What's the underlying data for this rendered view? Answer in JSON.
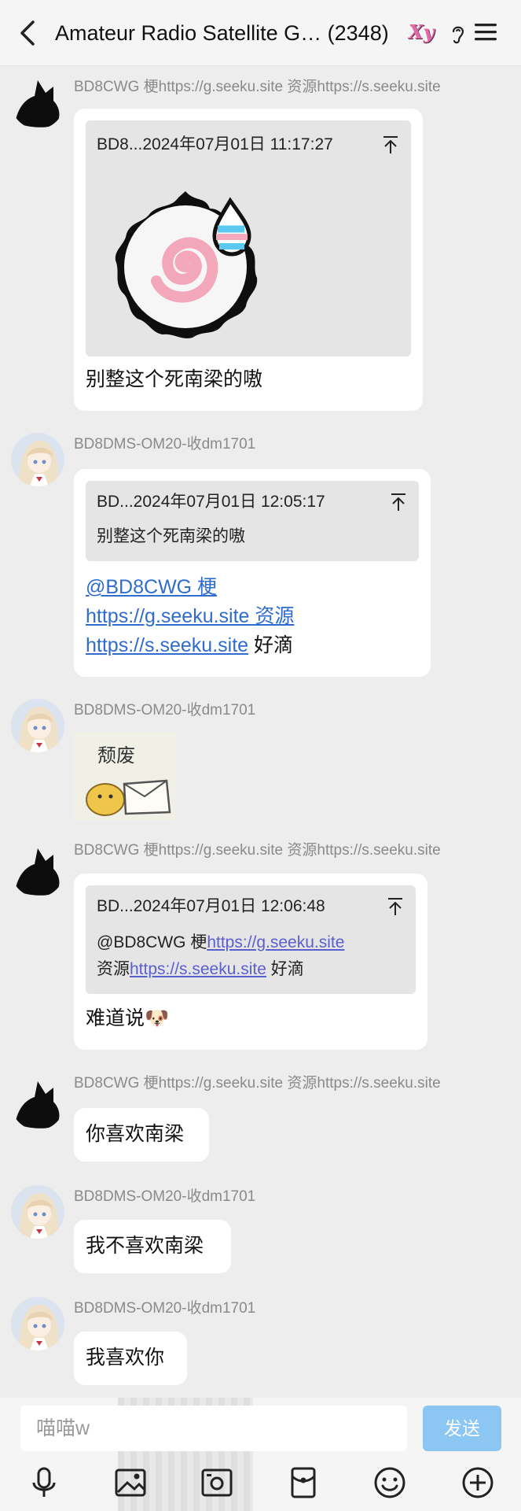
{
  "header": {
    "title": "Amateur Radio Satellite G… (2348)",
    "badge": "Xy",
    "back_icon": "chevron-left-icon",
    "ear_icon": "ear-icon",
    "menu_icon": "hamburger-menu-icon"
  },
  "messages": [
    {
      "sender": "BD8CWG 梗https://g.seeku.site  资源https://s.seeku.site",
      "avatar": "black-cat-silhouette",
      "quote_header": "BD8...2024年07月01日 11:17:27",
      "quote_image": "narutomaki-sticker",
      "text": "别整这个死南梁的嗷"
    },
    {
      "sender": "BD8DMS-OM20-收dm1701",
      "avatar": "anime-girl",
      "quote_header": "BD...2024年07月01日 12:05:17",
      "quote_text": "别整这个死南梁的嗷",
      "lines": [
        "@BD8CWG 梗",
        "https://g.seeku.site  资源",
        "https://s.seeku.site",
        "好滴"
      ]
    },
    {
      "sender": "BD8DMS-OM20-收dm1701",
      "avatar": "anime-girl",
      "sticker_text": "颓废"
    },
    {
      "sender": "BD8CWG 梗https://g.seeku.site  资源https://s.seeku.site",
      "avatar": "black-cat-silhouette",
      "quote_header": "BD...2024年07月01日 12:06:48",
      "quote_lines": [
        "@BD8CWG 梗",
        "https://g.seeku.site",
        "资源",
        "https://s.seeku.site",
        "好滴"
      ],
      "text": "难道说",
      "emoji": "🐶"
    },
    {
      "sender": "BD8CWG 梗https://g.seeku.site  资源https://s.seeku.site",
      "avatar": "black-cat-silhouette",
      "text": "你喜欢南梁"
    },
    {
      "sender": "BD8DMS-OM20-收dm1701",
      "avatar": "anime-girl",
      "text": "我不喜欢南梁"
    },
    {
      "sender": "BD8DMS-OM20-收dm1701",
      "avatar": "anime-girl",
      "text": "我喜欢你"
    }
  ],
  "input": {
    "placeholder": "喵喵w",
    "send_label": "发送"
  },
  "toolbar": [
    "microphone-icon",
    "image-icon",
    "camera-icon",
    "red-packet-icon",
    "emoji-icon",
    "plus-icon"
  ],
  "colors": {
    "link": "#2f6ccf",
    "send_button": "#8cc6f2",
    "background": "#ededed"
  }
}
